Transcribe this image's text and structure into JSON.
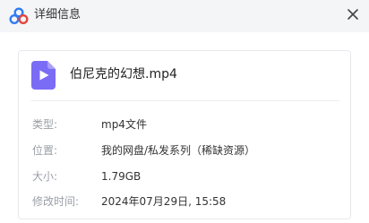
{
  "window": {
    "title": "详细信息",
    "close_icon": "close-icon",
    "app_icon": "cloud-drive-logo-icon"
  },
  "file": {
    "name": "伯尼克的幻想.mp4",
    "icon": "video-file-icon",
    "icon_color": "#7b6cf6"
  },
  "details": {
    "type_label": "类型:",
    "type_value": "mp4文件",
    "location_label": "位置:",
    "location_value": "我的网盘/私发系列（稀缺资源）",
    "size_label": "大小:",
    "size_value": "1.79GB",
    "modified_label": "修改时间:",
    "modified_value": "2024年07月29日, 15:58"
  },
  "colors": {
    "titlebar_bg": "#f4f5f7",
    "label_text": "#9a9ea6",
    "value_text": "#333333",
    "logo_blue": "#2f7bf5",
    "logo_red": "#e2453c"
  }
}
